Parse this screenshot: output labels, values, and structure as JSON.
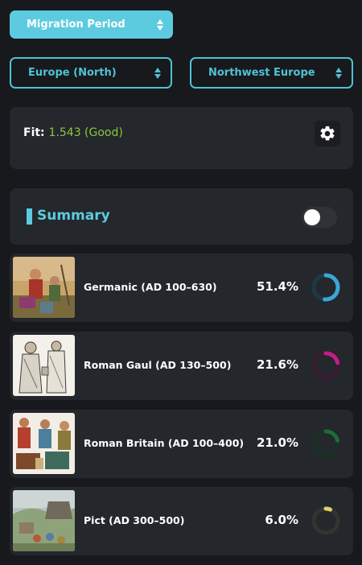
{
  "period_select": {
    "value": "Migration Period"
  },
  "region_select": {
    "value": "Europe (North)"
  },
  "subregion_select": {
    "value": "Northwest Europe"
  },
  "fit": {
    "label": "Fit:",
    "value": "1.543 (Good)"
  },
  "summary": {
    "title": "Summary",
    "toggle_on": false
  },
  "rows": [
    {
      "name": "Germanic (AD 100–630)",
      "percent": "51.4%",
      "fraction": 0.514,
      "color": "#3aa7d6",
      "track": "#1d3848"
    },
    {
      "name": "Roman Gaul (AD 130–500)",
      "percent": "21.6%",
      "fraction": 0.216,
      "color": "#c41c8a",
      "track": "#3a1a30"
    },
    {
      "name": "Roman Britain (AD 100–400)",
      "percent": "21.0%",
      "fraction": 0.21,
      "color": "#1f6b3a",
      "track": "#1c2f25"
    },
    {
      "name": "Pict (AD 300–500)",
      "percent": "6.0%",
      "fraction": 0.06,
      "color": "#e3cf6a",
      "track": "#33342f"
    }
  ]
}
